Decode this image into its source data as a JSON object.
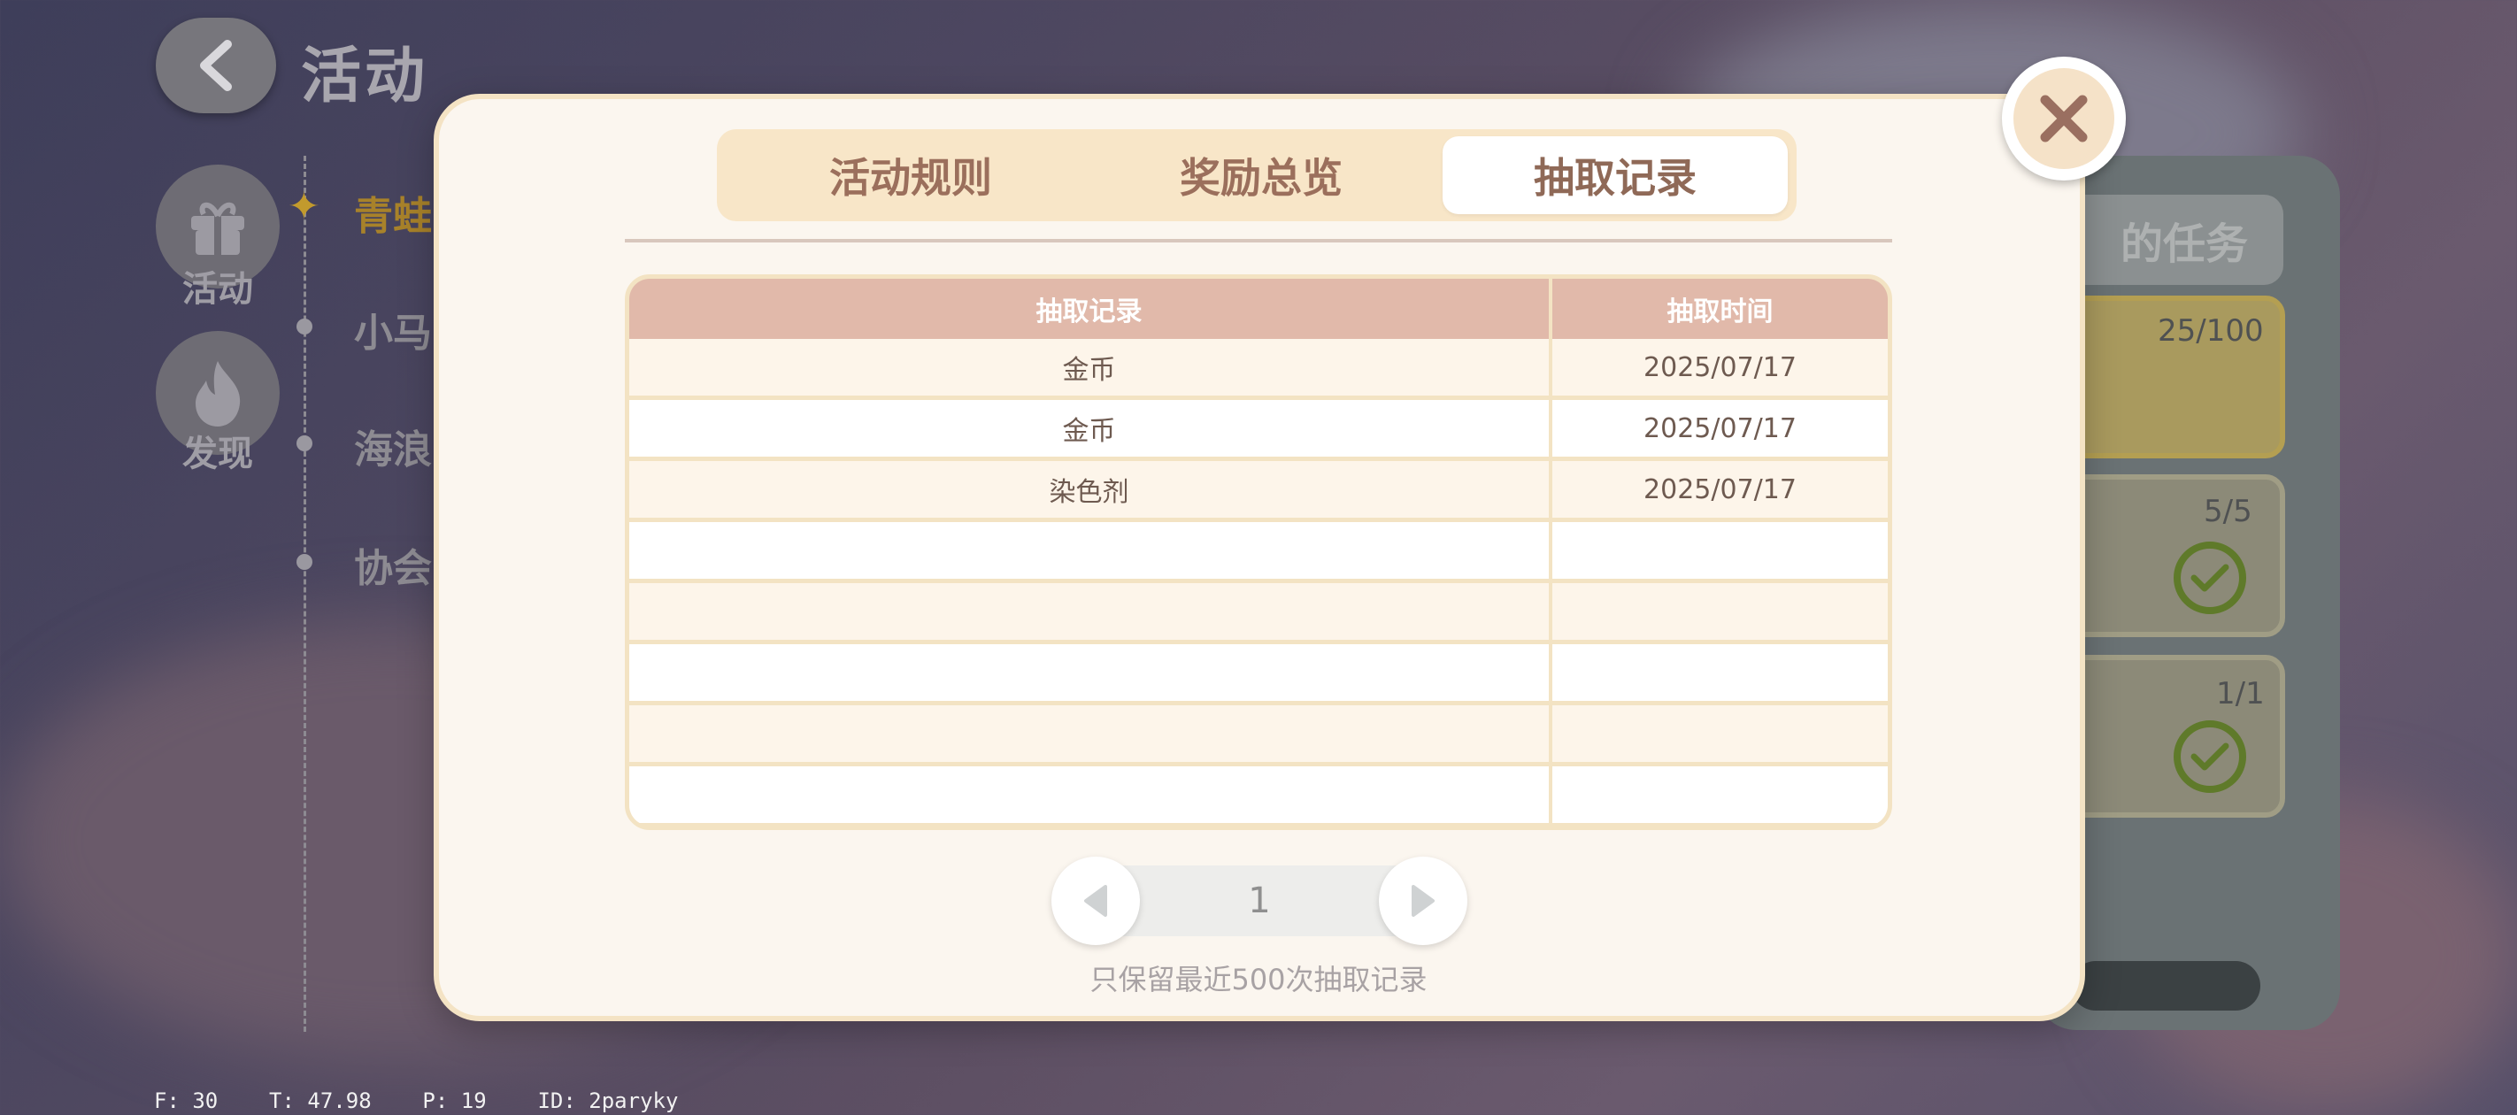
{
  "background": {
    "title": "活动",
    "side_buttons": [
      {
        "label": "活动",
        "icon": "gift-icon"
      },
      {
        "label": "发现",
        "icon": "flame-icon"
      }
    ],
    "timeline_items": [
      "青蛙",
      "小马",
      "海浪",
      "协会"
    ],
    "right_panel": {
      "header": "的任务",
      "cards": [
        {
          "count": "25/100"
        },
        {
          "count": "5/5",
          "completed": true
        },
        {
          "count": "1/1",
          "completed": true
        }
      ]
    },
    "debug_text": "F: 30    T: 47.98    P: 19    ID: 2paryky"
  },
  "modal": {
    "tabs": [
      {
        "label": "活动规则",
        "selected": false
      },
      {
        "label": "奖励总览",
        "selected": false
      },
      {
        "label": "抽取记录",
        "selected": true
      }
    ],
    "table": {
      "headers": [
        "抽取记录",
        "抽取时间"
      ],
      "rows": [
        [
          "金币",
          "2025/07/17"
        ],
        [
          "金币",
          "2025/07/17"
        ],
        [
          "染色剂",
          "2025/07/17"
        ],
        [
          "",
          ""
        ],
        [
          "",
          ""
        ],
        [
          "",
          ""
        ],
        [
          "",
          ""
        ],
        [
          "",
          ""
        ]
      ]
    },
    "pagination": {
      "current_page": "1"
    },
    "note": "只保留最近500次抽取记录"
  },
  "colors": {
    "modal_bg": "#fbf6ef",
    "tab_bar_bg": "#f8e6c8",
    "table_header_bg": "#e1b9aa",
    "text_brown": "#9b6f5c",
    "check_green": "#5f7a2a"
  }
}
